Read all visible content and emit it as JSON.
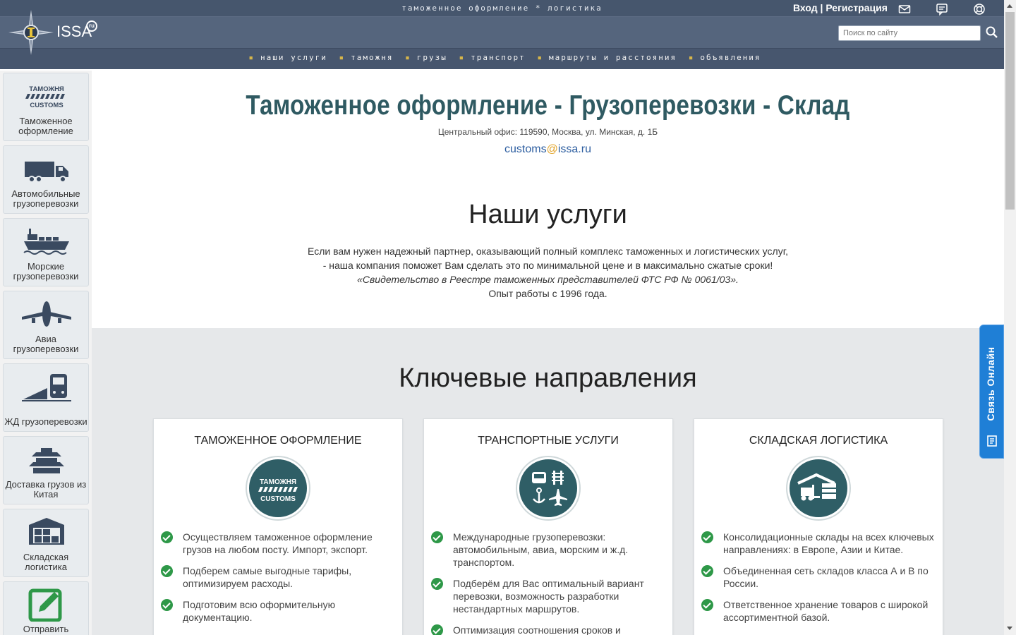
{
  "header": {
    "tagline": "таможенное оформление * логистика",
    "logo_text": "ISSA",
    "logo_badge": "ru",
    "login": "Вход | Регистрация",
    "search_placeholder": "Поиск по сайту",
    "icons": [
      "mail-icon",
      "chat-icon",
      "support-icon",
      "search-icon"
    ]
  },
  "nav": {
    "items": [
      "наши услуги",
      "таможня",
      "грузы",
      "транспорт",
      "маршруты и расстояния",
      "объявления"
    ]
  },
  "sidebar": {
    "items": [
      {
        "label": "Таможенное оформление",
        "icon": "customs-icon",
        "badge1": "ТАМОЖНЯ",
        "badge2": "CUSTOMS"
      },
      {
        "label": "Автомобильные грузоперевозки",
        "icon": "truck-icon"
      },
      {
        "label": "Морские грузоперевозки",
        "icon": "ship-icon"
      },
      {
        "label": "Авиа грузоперевозки",
        "icon": "plane-icon"
      },
      {
        "label": "ЖД грузоперевозки",
        "icon": "train-icon"
      },
      {
        "label": "Доставка грузов из Китая",
        "icon": "china-pagoda-icon"
      },
      {
        "label": "Складская логистика",
        "icon": "warehouse-icon"
      },
      {
        "label": "Отправить",
        "icon": "edit-icon"
      }
    ]
  },
  "main": {
    "title": "Таможенное оформление - Грузоперевозки - Склад",
    "address": "Центральный офис: 119590, Москва, ул. Минская, д. 1Б",
    "email_user": "customs",
    "email_at": "@",
    "email_domain": "issa.ru",
    "services_title": "Наши услуги",
    "intro_line1": "Если вам нужен надежный партнер, оказывающий полный комплекс таможенных и логистических услуг,",
    "intro_line2": "- наша компания поможет Вам сделать это по минимальной цене и в максимально сжатые сроки!",
    "intro_line3": "«Свидетельство в Реестре таможенных представителей ФТС РФ № 0061/03».",
    "intro_line4": "Опыт работы с 1996 года.",
    "directions_title": "Ключевые направления",
    "cards": [
      {
        "title": "ТАМОЖЕННОЕ ОФОРМЛЕНИЕ",
        "icon": "customs-badge-icon",
        "badge1": "ТАМОЖНЯ",
        "badge2": "CUSTOMS",
        "items": [
          "Осуществляем таможенное оформление грузов на любом посту. Импорт, экспорт.",
          "Подберем самые выгодные тарифы, оптимизируем расходы.",
          "Подготовим всю оформительную документацию."
        ]
      },
      {
        "title": "ТРАНСПОРТНЫЕ УСЛУГИ",
        "icon": "transport-modes-icon",
        "items": [
          "Международные грузоперевозки: автомобильным, авиа, морским и ж.д. транспортом.",
          "Подберём для Вас оптимальный вариант перевозки, возможность разработки нестандартных маршрутов.",
          "Оптимизация соотношения сроков и"
        ]
      },
      {
        "title": "СКЛАДСКАЯ ЛОГИСТИКА",
        "icon": "warehouse-forklift-icon",
        "items": [
          "Консолидационные склады на всех ключевых направлениях: в Европе, Азии и Китае.",
          "Объединенная сеть складов класса А и В по России.",
          "Ответственное хранение товаров с широкой ассортиментной базой."
        ]
      }
    ]
  },
  "online_chat": {
    "label": "Связь Онлайн",
    "icon": "chat-widget-icon"
  },
  "colors": {
    "header": "#47566e",
    "title": "#2f5a62",
    "accent_green": "#2e9848",
    "chat_blue": "#1f7fd6",
    "email_at": "#e2a42a"
  }
}
